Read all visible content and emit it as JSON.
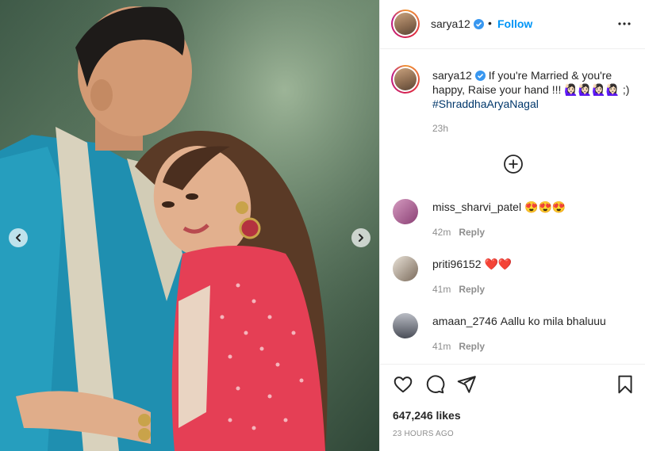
{
  "post": {
    "username": "sarya12",
    "follow_label": "Follow",
    "separator": "•",
    "caption_text": "If you're Married & you're happy, Raise your hand !!! 🙋🏻‍♀️🙋🏻‍♀️🙋🏻‍♀️🙋🏻‍♀️ ;)",
    "hashtag": "#ShraddhaAryaNagal",
    "caption_time": "23h",
    "likes": "647,246 likes",
    "posted_ago": "23 HOURS AGO"
  },
  "comments": [
    {
      "username": "miss_sharvi_patel",
      "text": "😍😍😍",
      "time": "42m",
      "reply_label": "Reply"
    },
    {
      "username": "priti96152",
      "text": "❤️❤️",
      "time": "41m",
      "reply_label": "Reply"
    },
    {
      "username": "amaan_2746",
      "text": "Aallu ko mila bhaluuu",
      "time": "41m",
      "reply_label": "Reply"
    }
  ],
  "colors": {
    "accent": "#0095f6",
    "hashtag": "#00376b",
    "muted": "#8e8e8e",
    "text": "#262626",
    "verified": "#3897f0"
  },
  "icons": {
    "more": "more-icon",
    "add_comment": "add-comment-icon",
    "like": "heart-icon",
    "comment": "comment-icon",
    "share": "share-icon",
    "save": "bookmark-icon",
    "prev": "chevron-left-icon",
    "next": "chevron-right-icon"
  }
}
